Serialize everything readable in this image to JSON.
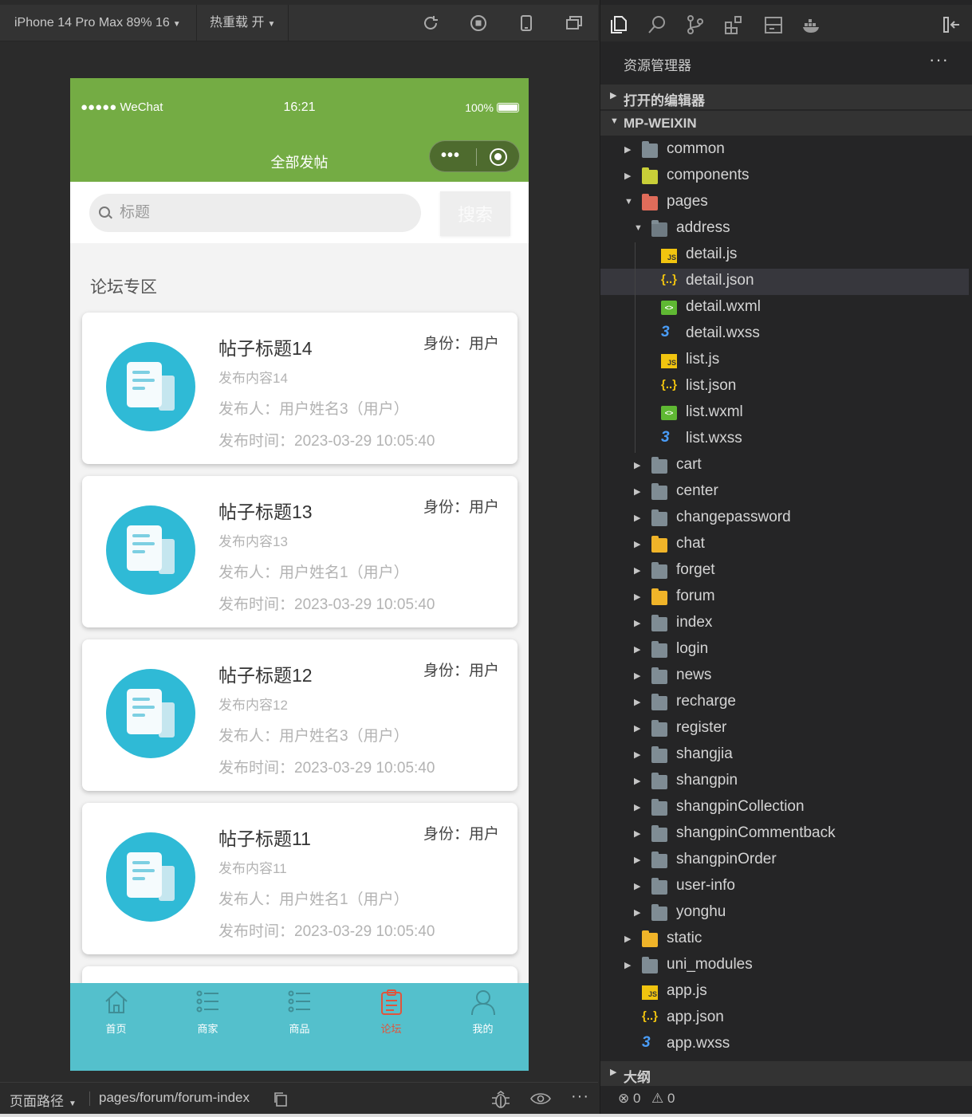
{
  "toolbar": {
    "device": "iPhone 14 Pro Max 89% 16",
    "hot_reload": "热重载 开"
  },
  "phone": {
    "status": {
      "carrier": "●●●●● WeChat",
      "time": "16:21",
      "battery": "100%"
    },
    "nav_title": "全部发帖",
    "search": {
      "placeholder": "标题",
      "button": "搜索"
    },
    "section_title": "论坛专区",
    "posts": [
      {
        "title": "帖子标题14",
        "role": "身份：用户",
        "content": "发布内容14",
        "author": "发布人：用户姓名3（用户）",
        "time": "发布时间：2023-03-29 10:05:40"
      },
      {
        "title": "帖子标题13",
        "role": "身份：用户",
        "content": "发布内容13",
        "author": "发布人：用户姓名1（用户）",
        "time": "发布时间：2023-03-29 10:05:40"
      },
      {
        "title": "帖子标题12",
        "role": "身份：用户",
        "content": "发布内容12",
        "author": "发布人：用户姓名3（用户）",
        "time": "发布时间：2023-03-29 10:05:40"
      },
      {
        "title": "帖子标题11",
        "role": "身份：用户",
        "content": "发布内容11",
        "author": "发布人：用户姓名1（用户）",
        "time": "发布时间：2023-03-29 10:05:40"
      }
    ],
    "tabs": [
      {
        "label": "首页",
        "icon": "home-icon"
      },
      {
        "label": "商家",
        "icon": "list-icon"
      },
      {
        "label": "商品",
        "icon": "list-icon"
      },
      {
        "label": "论坛",
        "icon": "clipboard-icon",
        "active": true
      },
      {
        "label": "我的",
        "icon": "user-icon"
      }
    ],
    "theme": {
      "navbar": "#74ac44",
      "tabbar": "#54c0cc",
      "active_tab": "#e0553c",
      "avatar": "#2fbad6"
    }
  },
  "footer": {
    "path_label": "页面路径",
    "path_value": "pages/forum/forum-index"
  },
  "explorer": {
    "title": "资源管理器",
    "more": "···",
    "open_editors": "打开的编辑器",
    "project": "MP-WEIXIN",
    "tree": [
      {
        "name": "common",
        "kind": "folder",
        "depth": 1,
        "open": false
      },
      {
        "name": "components",
        "kind": "folder-yellowgreen",
        "depth": 1,
        "open": false
      },
      {
        "name": "pages",
        "kind": "folder-red",
        "depth": 1,
        "open": true
      },
      {
        "name": "address",
        "kind": "folder",
        "depth": 2,
        "open": true
      },
      {
        "name": "detail.js",
        "kind": "js",
        "depth": 3
      },
      {
        "name": "detail.json",
        "kind": "json",
        "depth": 3,
        "selected": true
      },
      {
        "name": "detail.wxml",
        "kind": "wxml",
        "depth": 3
      },
      {
        "name": "detail.wxss",
        "kind": "wxss",
        "depth": 3
      },
      {
        "name": "list.js",
        "kind": "js",
        "depth": 3
      },
      {
        "name": "list.json",
        "kind": "json",
        "depth": 3
      },
      {
        "name": "list.wxml",
        "kind": "wxml",
        "depth": 3
      },
      {
        "name": "list.wxss",
        "kind": "wxss",
        "depth": 3
      },
      {
        "name": "cart",
        "kind": "folder",
        "depth": 2,
        "open": false
      },
      {
        "name": "center",
        "kind": "folder",
        "depth": 2,
        "open": false
      },
      {
        "name": "changepassword",
        "kind": "folder",
        "depth": 2,
        "open": false
      },
      {
        "name": "chat",
        "kind": "folder-yellow",
        "depth": 2,
        "open": false
      },
      {
        "name": "forget",
        "kind": "folder",
        "depth": 2,
        "open": false
      },
      {
        "name": "forum",
        "kind": "folder-yellow",
        "depth": 2,
        "open": false
      },
      {
        "name": "index",
        "kind": "folder",
        "depth": 2,
        "open": false
      },
      {
        "name": "login",
        "kind": "folder",
        "depth": 2,
        "open": false
      },
      {
        "name": "news",
        "kind": "folder",
        "depth": 2,
        "open": false
      },
      {
        "name": "recharge",
        "kind": "folder",
        "depth": 2,
        "open": false
      },
      {
        "name": "register",
        "kind": "folder",
        "depth": 2,
        "open": false
      },
      {
        "name": "shangjia",
        "kind": "folder",
        "depth": 2,
        "open": false
      },
      {
        "name": "shangpin",
        "kind": "folder",
        "depth": 2,
        "open": false
      },
      {
        "name": "shangpinCollection",
        "kind": "folder",
        "depth": 2,
        "open": false
      },
      {
        "name": "shangpinCommentback",
        "kind": "folder",
        "depth": 2,
        "open": false
      },
      {
        "name": "shangpinOrder",
        "kind": "folder",
        "depth": 2,
        "open": false
      },
      {
        "name": "user-info",
        "kind": "folder",
        "depth": 2,
        "open": false
      },
      {
        "name": "yonghu",
        "kind": "folder",
        "depth": 2,
        "open": false
      },
      {
        "name": "static",
        "kind": "folder-yellow",
        "depth": 1,
        "open": false
      },
      {
        "name": "uni_modules",
        "kind": "folder",
        "depth": 1,
        "open": false
      },
      {
        "name": "app.js",
        "kind": "js",
        "depth": 1
      },
      {
        "name": "app.json",
        "kind": "json",
        "depth": 1
      },
      {
        "name": "app.wxss",
        "kind": "wxss",
        "depth": 1
      }
    ],
    "outline": "大纲",
    "problems": {
      "errors": "0",
      "warnings": "0"
    }
  }
}
